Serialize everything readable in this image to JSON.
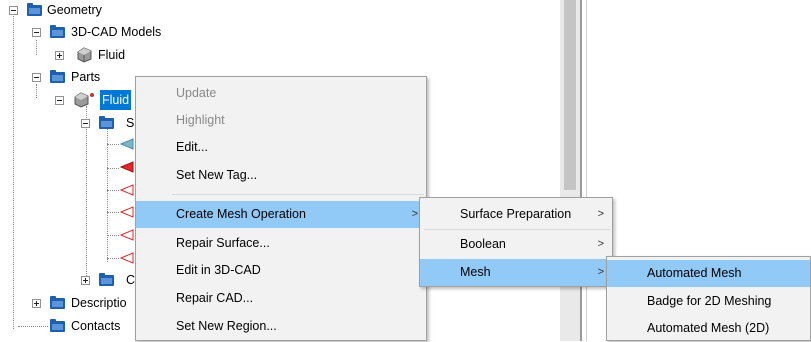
{
  "tree": {
    "geometry": "Geometry",
    "cad_models": "3D-CAD Models",
    "fluid_cad": "Fluid",
    "parts": "Parts",
    "fluid_part": "Fluid",
    "surfaces_partial": "S",
    "contacts_partial": "C",
    "descriptions": "Descriptio",
    "contacts": "Contacts"
  },
  "context_menu": {
    "items": [
      {
        "label": "Update",
        "enabled": false
      },
      {
        "label": "Highlight",
        "enabled": false
      },
      {
        "label": "Edit...",
        "enabled": true
      },
      {
        "label": "Set New Tag...",
        "enabled": true
      },
      {
        "label": "Create Mesh Operation",
        "enabled": true,
        "submenu": true,
        "highlighted": true
      },
      {
        "label": "Repair Surface...",
        "enabled": true
      },
      {
        "label": "Edit in 3D-CAD",
        "enabled": true
      },
      {
        "label": "Repair CAD...",
        "enabled": true
      },
      {
        "label": "Set New Region...",
        "enabled": true
      }
    ]
  },
  "submenu": {
    "items": [
      {
        "label": "Surface Preparation",
        "submenu": true
      },
      {
        "label": "Boolean",
        "submenu": true
      },
      {
        "label": "Mesh",
        "submenu": true,
        "highlighted": true
      }
    ]
  },
  "mesh_submenu": {
    "items": [
      {
        "label": "Automated Mesh",
        "highlighted": true
      },
      {
        "label": "Badge for 2D Meshing"
      },
      {
        "label": "Automated Mesh (2D)"
      }
    ]
  },
  "colors": {
    "selection": "#0078d7",
    "menu_highlight": "#91c9f7",
    "folder": "#1f5fb0"
  }
}
